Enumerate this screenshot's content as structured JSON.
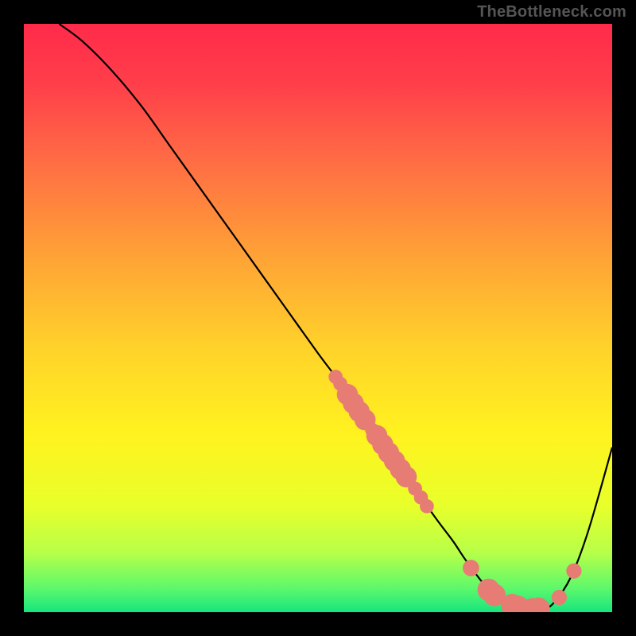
{
  "watermark": "TheBottleneck.com",
  "chart_data": {
    "type": "line",
    "title": "",
    "xlabel": "",
    "ylabel": "",
    "xlim": [
      0,
      100
    ],
    "ylim": [
      0,
      100
    ],
    "series": [
      {
        "name": "curve",
        "color": "#000000",
        "x": [
          6,
          10,
          15,
          20,
          25,
          30,
          35,
          40,
          45,
          50,
          53,
          55,
          60,
          65,
          70,
          73,
          75,
          78,
          80,
          83,
          85,
          88,
          90,
          93,
          96,
          100
        ],
        "y": [
          100,
          97,
          92,
          86,
          79,
          72,
          65,
          58,
          51,
          44,
          40,
          37,
          30,
          23,
          16,
          12,
          9,
          5,
          3,
          1.2,
          0.5,
          0.5,
          1.5,
          6,
          14,
          28
        ]
      }
    ],
    "markers": [
      {
        "cx": 53.0,
        "cy": 40.0,
        "r": 1.2
      },
      {
        "cx": 53.8,
        "cy": 38.8,
        "r": 1.2
      },
      {
        "cx": 55.0,
        "cy": 37.0,
        "r": 1.8
      },
      {
        "cx": 56.0,
        "cy": 35.5,
        "r": 1.8
      },
      {
        "cx": 57.0,
        "cy": 34.1,
        "r": 1.8
      },
      {
        "cx": 58.0,
        "cy": 32.7,
        "r": 1.8
      },
      {
        "cx": 59.2,
        "cy": 31.0,
        "r": 1.2
      },
      {
        "cx": 60.0,
        "cy": 30.0,
        "r": 1.8
      },
      {
        "cx": 61.0,
        "cy": 28.5,
        "r": 1.8
      },
      {
        "cx": 62.0,
        "cy": 27.1,
        "r": 1.8
      },
      {
        "cx": 63.0,
        "cy": 25.7,
        "r": 1.8
      },
      {
        "cx": 64.0,
        "cy": 24.3,
        "r": 1.8
      },
      {
        "cx": 65.0,
        "cy": 23.0,
        "r": 1.8
      },
      {
        "cx": 66.5,
        "cy": 21.0,
        "r": 1.2
      },
      {
        "cx": 67.5,
        "cy": 19.5,
        "r": 1.2
      },
      {
        "cx": 68.5,
        "cy": 18.0,
        "r": 1.2
      },
      {
        "cx": 76.0,
        "cy": 7.5,
        "r": 1.4
      },
      {
        "cx": 79.0,
        "cy": 3.8,
        "r": 1.9
      },
      {
        "cx": 80.0,
        "cy": 2.9,
        "r": 1.9
      },
      {
        "cx": 83.0,
        "cy": 1.2,
        "r": 1.9
      },
      {
        "cx": 84.0,
        "cy": 0.9,
        "r": 1.9
      },
      {
        "cx": 86.5,
        "cy": 0.5,
        "r": 1.9
      },
      {
        "cx": 87.5,
        "cy": 0.6,
        "r": 1.9
      },
      {
        "cx": 91.0,
        "cy": 2.5,
        "r": 1.3
      },
      {
        "cx": 93.5,
        "cy": 7.0,
        "r": 1.3
      }
    ],
    "marker_color": "#E77C74",
    "gradient_stops": [
      {
        "offset": 0.0,
        "color": "#FF2A4A"
      },
      {
        "offset": 0.1,
        "color": "#FF3E4A"
      },
      {
        "offset": 0.22,
        "color": "#FF6845"
      },
      {
        "offset": 0.4,
        "color": "#FFA436"
      },
      {
        "offset": 0.55,
        "color": "#FFD22A"
      },
      {
        "offset": 0.7,
        "color": "#FFF31F"
      },
      {
        "offset": 0.82,
        "color": "#E8FF2A"
      },
      {
        "offset": 0.9,
        "color": "#B6FF49"
      },
      {
        "offset": 0.96,
        "color": "#5CF86C"
      },
      {
        "offset": 1.0,
        "color": "#17E57F"
      }
    ]
  }
}
